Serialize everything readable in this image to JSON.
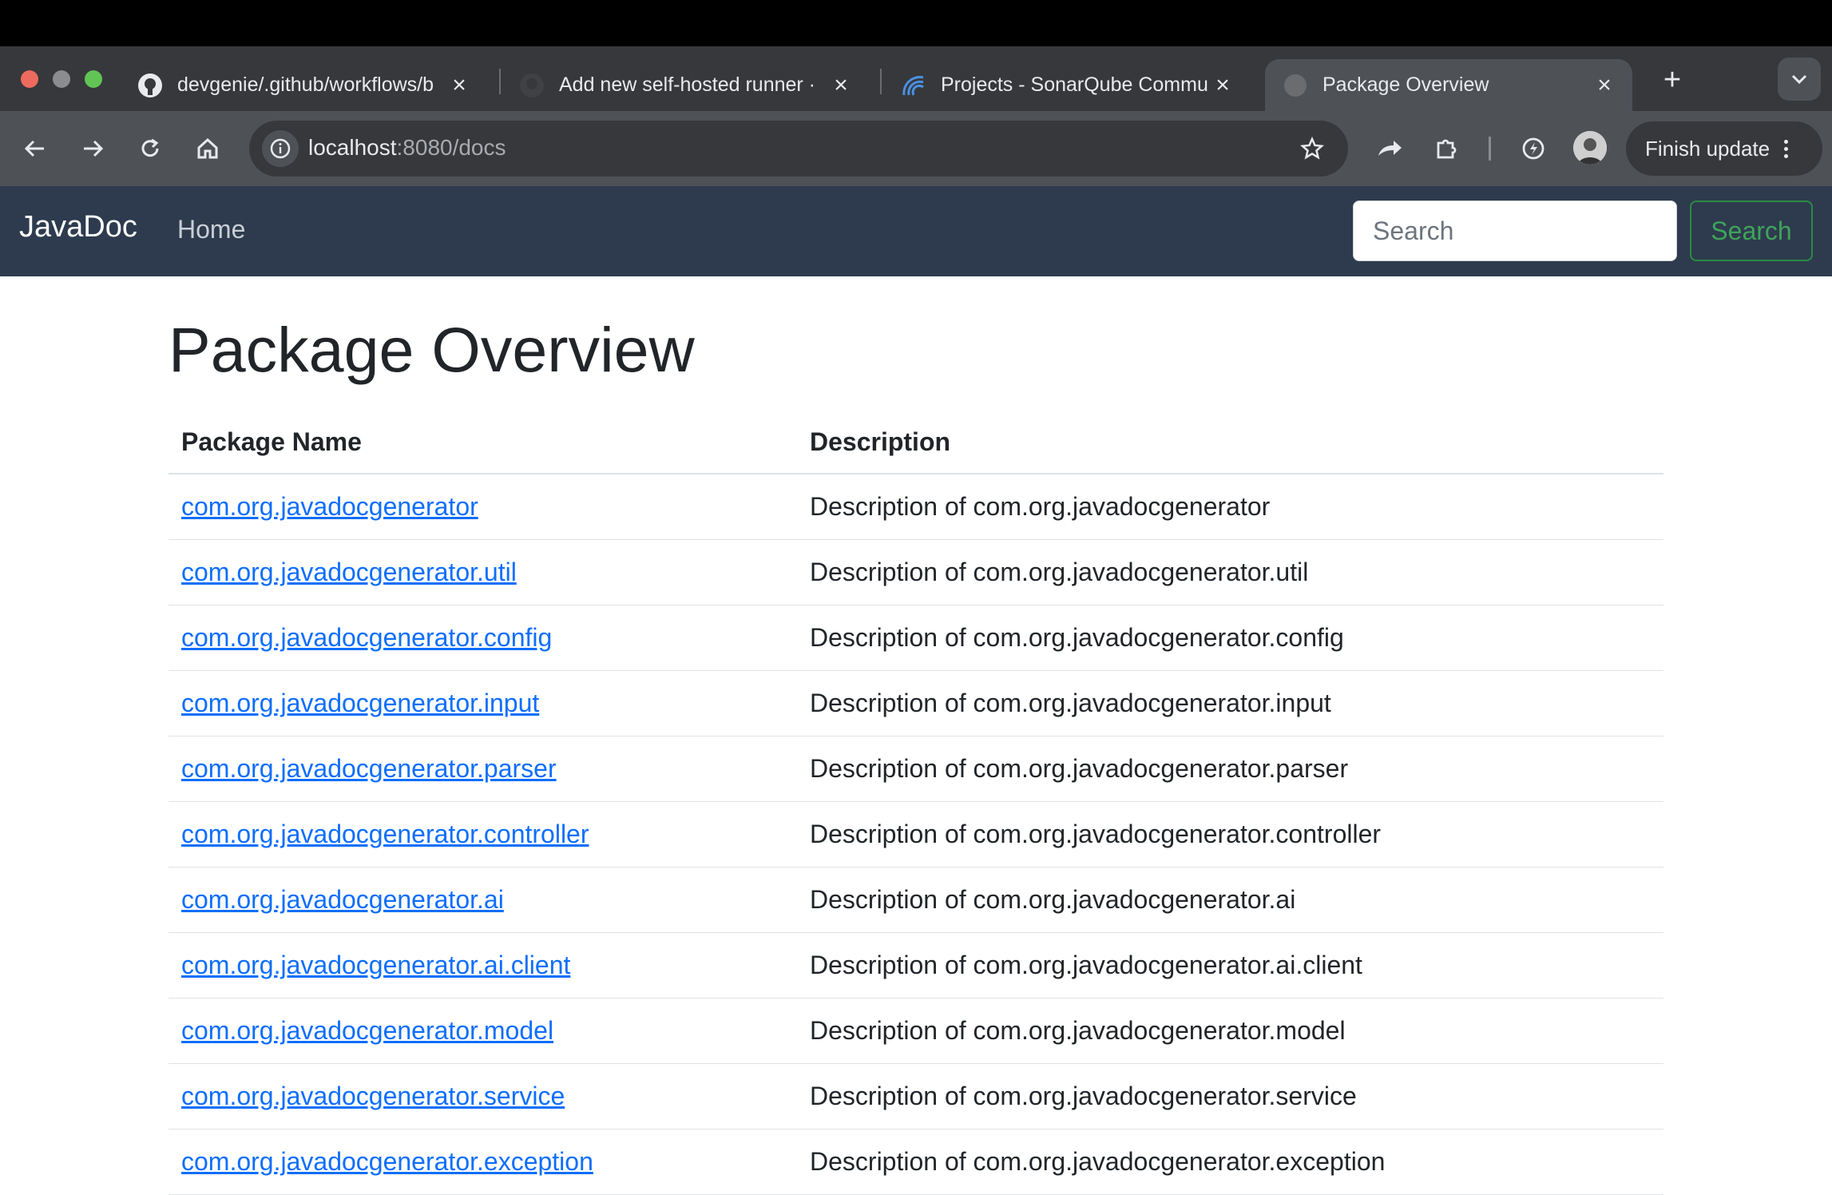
{
  "browser": {
    "tabs": [
      {
        "title": "devgenie/.github/workflows/b",
        "icon": "github-icon"
      },
      {
        "title": "Add new self-hosted runner ·",
        "icon": "github-icon"
      },
      {
        "title": "Projects - SonarQube Commu",
        "icon": "sonarqube-icon"
      },
      {
        "title": "Package Overview",
        "icon": "globe-icon",
        "active": true
      }
    ],
    "url": {
      "host": "localhost",
      "path": ":8080/docs"
    },
    "finish_update_label": "Finish update"
  },
  "navbar": {
    "brand": "JavaDoc",
    "home_link": "Home",
    "search_placeholder": "Search",
    "search_button": "Search"
  },
  "page": {
    "title": "Package Overview",
    "columns": {
      "name": "Package Name",
      "description": "Description"
    },
    "packages": [
      {
        "name": "com.org.javadocgenerator",
        "description": "Description of com.org.javadocgenerator"
      },
      {
        "name": "com.org.javadocgenerator.util",
        "description": "Description of com.org.javadocgenerator.util"
      },
      {
        "name": "com.org.javadocgenerator.config",
        "description": "Description of com.org.javadocgenerator.config"
      },
      {
        "name": "com.org.javadocgenerator.input",
        "description": "Description of com.org.javadocgenerator.input"
      },
      {
        "name": "com.org.javadocgenerator.parser",
        "description": "Description of com.org.javadocgenerator.parser"
      },
      {
        "name": "com.org.javadocgenerator.controller",
        "description": "Description of com.org.javadocgenerator.controller"
      },
      {
        "name": "com.org.javadocgenerator.ai",
        "description": "Description of com.org.javadocgenerator.ai"
      },
      {
        "name": "com.org.javadocgenerator.ai.client",
        "description": "Description of com.org.javadocgenerator.ai.client"
      },
      {
        "name": "com.org.javadocgenerator.model",
        "description": "Description of com.org.javadocgenerator.model"
      },
      {
        "name": "com.org.javadocgenerator.service",
        "description": "Description of com.org.javadocgenerator.service"
      },
      {
        "name": "com.org.javadocgenerator.exception",
        "description": "Description of com.org.javadocgenerator.exception"
      }
    ]
  },
  "colors": {
    "navbar": "#2e3b4e",
    "link": "#0d6efd",
    "search_button": "#3fa35a"
  }
}
